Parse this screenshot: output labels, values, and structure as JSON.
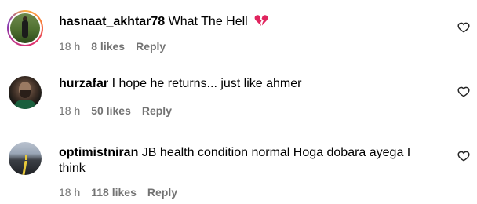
{
  "comments": [
    {
      "username": "hasnaat_akhtar78",
      "text": "What The Hell",
      "emoji": "broken-heart-icon",
      "time": "18 h",
      "likes": "8 likes",
      "reply": "Reply"
    },
    {
      "username": "hurzafar",
      "text": "I hope he returns... just like ahmer",
      "time": "18 h",
      "likes": "50 likes",
      "reply": "Reply"
    },
    {
      "username": "optimistniran",
      "text": "JB health condition normal Hoga dobara ayega I think",
      "time": "18 h",
      "likes": "118 likes",
      "reply": "Reply"
    }
  ],
  "colors": {
    "text": "#000000",
    "meta": "#737373",
    "emoji": "#e0245e"
  }
}
